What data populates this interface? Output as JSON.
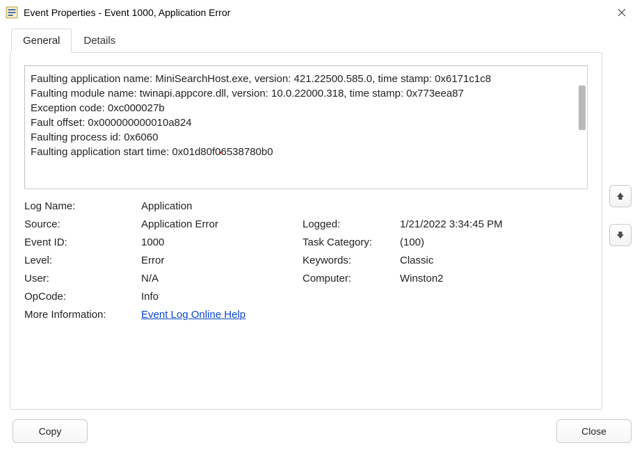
{
  "window": {
    "title": "Event Properties - Event 1000, Application Error"
  },
  "tabs": {
    "general": "General",
    "details": "Details"
  },
  "description_lines": [
    "Faulting application name: MiniSearchHost.exe, version: 421.22500.585.0, time stamp: 0x6171c1c8",
    "Faulting module name: twinapi.appcore.dll, version: 10.0.22000.318, time stamp: 0x773eea87",
    "Exception code: 0xc000027b",
    "Fault offset: 0x000000000010a824",
    "Faulting process id: 0x6060",
    "Faulting application start time: 0x01d80f06538780b0"
  ],
  "properties": {
    "log_name_label": "Log Name:",
    "log_name_value": "Application",
    "source_label": "Source:",
    "source_value": "Application Error",
    "logged_label": "Logged:",
    "logged_value": "1/21/2022 3:34:45 PM",
    "event_id_label": "Event ID:",
    "event_id_value": "1000",
    "task_category_label": "Task Category:",
    "task_category_value": "(100)",
    "level_label": "Level:",
    "level_value": "Error",
    "keywords_label": "Keywords:",
    "keywords_value": "Classic",
    "user_label": "User:",
    "user_value": "N/A",
    "computer_label": "Computer:",
    "computer_value": "Winston2",
    "opcode_label": "OpCode:",
    "opcode_value": "Info",
    "more_info_label": "More Information:",
    "more_info_link": "Event Log Online Help"
  },
  "buttons": {
    "copy": "Copy",
    "close": "Close"
  },
  "icons": {
    "app": "event-log-icon",
    "close_window": "close-icon",
    "up": "arrow-up-icon",
    "down": "arrow-down-icon"
  }
}
